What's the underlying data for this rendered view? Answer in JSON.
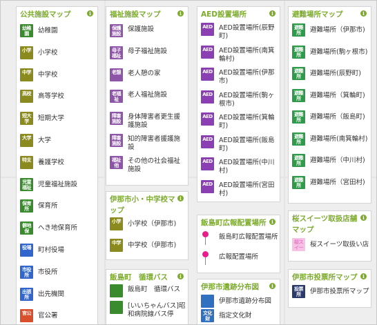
{
  "colors": {
    "title": "#7cab2d",
    "public_green": "#3a8a2e",
    "school_olive": "#8a8a1e",
    "welfare_purple": "#8d54a8",
    "aed_purple": "#8a3fb2",
    "evac_green": "#2e9a4a",
    "office_blue": "#3366cc",
    "sweets_pink": "#e878c8",
    "vote_navy": "#2a3a6a",
    "culture_blue": "#3070c0"
  },
  "public": {
    "title": "公共施設マップ",
    "items": [
      {
        "icon": "幼稚園",
        "label": "幼稚園"
      },
      {
        "icon": "小学",
        "label": "小学校"
      },
      {
        "icon": "中学",
        "label": "中学校"
      },
      {
        "icon": "高校",
        "label": "高等学校"
      },
      {
        "icon": "短大学",
        "label": "短期大学"
      },
      {
        "icon": "大学",
        "label": "大学"
      },
      {
        "icon": "特支",
        "label": "養護学校"
      },
      {
        "icon": "児童福祉",
        "label": "児童福祉施設"
      },
      {
        "icon": "保育所",
        "label": "保育所"
      },
      {
        "icon": "僻地保",
        "label": "へき地保育所"
      },
      {
        "icon": "役場",
        "label": "町村役場"
      },
      {
        "icon": "市役所",
        "label": "市役所"
      },
      {
        "icon": "出張所",
        "label": "出先機関"
      },
      {
        "icon": "官公",
        "label": "官公署"
      }
    ]
  },
  "welfare": {
    "title": "福祉施設マップ",
    "items": [
      {
        "icon": "保護施設",
        "label": "保護施設"
      },
      {
        "icon": "母子福祉",
        "label": "母子福祉施設"
      },
      {
        "icon": "老憩",
        "label": "老人憩の家"
      },
      {
        "icon": "老福祉",
        "label": "老人福祉施設"
      },
      {
        "icon": "障害施設",
        "label": "身体障害者更生援護施設"
      },
      {
        "icon": "障害施設",
        "label": "知的障害者援護施設"
      },
      {
        "icon": "福祉他",
        "label": "その他の社会福祉施設"
      }
    ]
  },
  "aed": {
    "title": "AED設置場所",
    "icon": "AED",
    "items": [
      {
        "label": "AED設置場所(辰野町)"
      },
      {
        "label": "AED設置場所(南箕輪村)"
      },
      {
        "label": "AED設置場所(伊那市)"
      },
      {
        "label": "AED設置場所(駒ヶ根市)"
      },
      {
        "label": "AED設置場所(箕輪町)"
      },
      {
        "label": "AED設置場所(飯島町)"
      },
      {
        "label": "AED設置場所(中川村)"
      },
      {
        "label": "AED設置場所(宮田村)"
      }
    ]
  },
  "evac": {
    "title": "避難場所マップ",
    "icon": "避難所",
    "items": [
      {
        "label": "避難場所（伊那市)"
      },
      {
        "label": "避難場所(駒ヶ根市)"
      },
      {
        "label": "避難場所(辰野町)"
      },
      {
        "label": "避難場所（箕輪町)"
      },
      {
        "label": "避難場所（飯島町)"
      },
      {
        "label": "避難場所(南箕輪村)"
      },
      {
        "label": "避難場所（中川村)"
      },
      {
        "label": "避難場所（宮田村)"
      }
    ]
  },
  "inacity_school": {
    "title": "伊那市小・中学校マップ",
    "items": [
      {
        "icon": "小学",
        "label": "小学校（伊那市)"
      },
      {
        "icon": "中学",
        "label": "中学校（伊那市)"
      }
    ]
  },
  "iijima_bus": {
    "title": "飯島町　循環バス",
    "items": [
      {
        "label": "飯島町　循環バス"
      },
      {
        "label": "[いいちゃんバス]昭和病院線バス停"
      }
    ]
  },
  "iijima_pr": {
    "title": "飯島町広報配置場所",
    "items": [
      {
        "label": "飯島町広報配置場所"
      },
      {
        "label": "広報配置場所"
      }
    ]
  },
  "ruins": {
    "title": "伊那市遺跡分布図",
    "items": [
      {
        "label": "伊那市遺跡分布図"
      },
      {
        "icon": "文化財",
        "label": "指定文化財"
      }
    ]
  },
  "sweets": {
    "title": "桜スイーツ取扱店舗マップ",
    "items": [
      {
        "icon": "桜スイーツ",
        "label": "桜スイーツ取扱い店"
      }
    ]
  },
  "vote": {
    "title": "伊那市投票所マップ",
    "items": [
      {
        "icon": "投票所",
        "label": "伊那市投票所マップ"
      }
    ]
  },
  "info_glyph": "i"
}
